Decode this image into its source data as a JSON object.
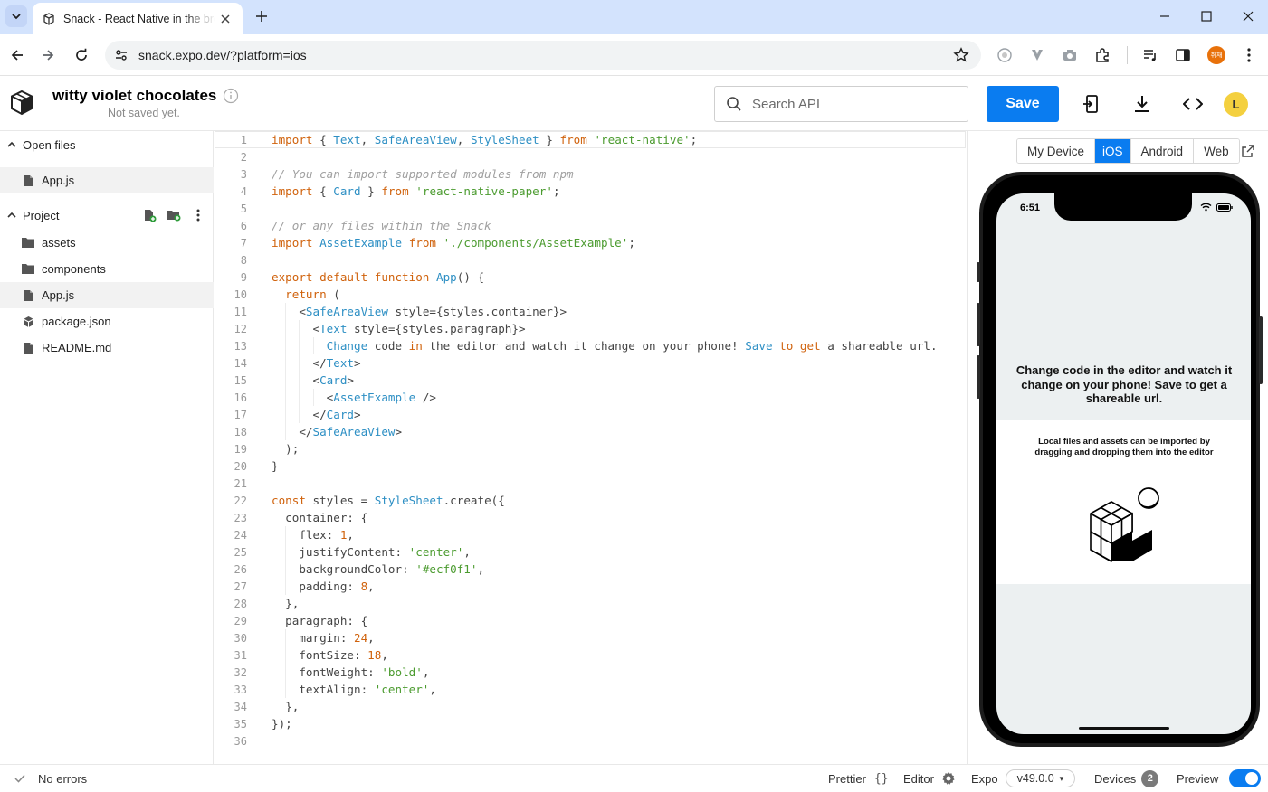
{
  "browser": {
    "tab_title": "Snack - React Native in the browser",
    "url": "snack.expo.dev/?platform=ios",
    "profile_badge": "취재"
  },
  "header": {
    "snack_name": "witty violet chocolates",
    "save_status": "Not saved yet.",
    "search_placeholder": "Search API",
    "save_label": "Save",
    "user_initial": "L"
  },
  "sidebar": {
    "open_files_label": "Open files",
    "open_files": [
      "App.js"
    ],
    "project_label": "Project",
    "project_items": [
      {
        "name": "assets",
        "icon": "folder-icon"
      },
      {
        "name": "components",
        "icon": "folder-icon"
      },
      {
        "name": "App.js",
        "icon": "file-icon"
      },
      {
        "name": "package.json",
        "icon": "package-icon"
      },
      {
        "name": "README.md",
        "icon": "file-icon"
      }
    ]
  },
  "editor": {
    "lines": [
      [
        [
          "kw",
          "import"
        ],
        [
          "pl",
          " { "
        ],
        [
          "id",
          "Text"
        ],
        [
          "pl",
          ", "
        ],
        [
          "id",
          "SafeAreaView"
        ],
        [
          "pl",
          ", "
        ],
        [
          "id",
          "StyleSheet"
        ],
        [
          "pl",
          " } "
        ],
        [
          "kw",
          "from"
        ],
        [
          "pl",
          " "
        ],
        [
          "str",
          "'react-native'"
        ],
        [
          "pl",
          ";"
        ]
      ],
      [],
      [
        [
          "cm",
          "// You can import supported modules from npm"
        ]
      ],
      [
        [
          "kw",
          "import"
        ],
        [
          "pl",
          " { "
        ],
        [
          "id",
          "Card"
        ],
        [
          "pl",
          " } "
        ],
        [
          "kw",
          "from"
        ],
        [
          "pl",
          " "
        ],
        [
          "str",
          "'react-native-paper'"
        ],
        [
          "pl",
          ";"
        ]
      ],
      [],
      [
        [
          "cm",
          "// or any files within the Snack"
        ]
      ],
      [
        [
          "kw",
          "import"
        ],
        [
          "pl",
          " "
        ],
        [
          "id",
          "AssetExample"
        ],
        [
          "pl",
          " "
        ],
        [
          "kw",
          "from"
        ],
        [
          "pl",
          " "
        ],
        [
          "str",
          "'./components/AssetExample'"
        ],
        [
          "pl",
          ";"
        ]
      ],
      [],
      [
        [
          "kw",
          "export default function"
        ],
        [
          "pl",
          " "
        ],
        [
          "id",
          "App"
        ],
        [
          "pl",
          "() {"
        ]
      ],
      [
        [
          "pl",
          "  "
        ],
        [
          "kw",
          "return"
        ],
        [
          "pl",
          " ("
        ]
      ],
      [
        [
          "pl",
          "    <"
        ],
        [
          "id",
          "SafeAreaView"
        ],
        [
          "pl",
          " style={styles.container}>"
        ]
      ],
      [
        [
          "pl",
          "      <"
        ],
        [
          "id",
          "Text"
        ],
        [
          "pl",
          " style={styles.paragraph}>"
        ]
      ],
      [
        [
          "pl",
          "        "
        ],
        [
          "id",
          "Change"
        ],
        [
          "pl",
          " code "
        ],
        [
          "kw",
          "in"
        ],
        [
          "pl",
          " the editor and watch it change on your phone! "
        ],
        [
          "id",
          "Save"
        ],
        [
          "pl",
          " "
        ],
        [
          "kw",
          "to"
        ],
        [
          "pl",
          " "
        ],
        [
          "kw",
          "get"
        ],
        [
          "pl",
          " a shareable url."
        ]
      ],
      [
        [
          "pl",
          "      </"
        ],
        [
          "id",
          "Text"
        ],
        [
          "pl",
          ">"
        ]
      ],
      [
        [
          "pl",
          "      <"
        ],
        [
          "id",
          "Card"
        ],
        [
          "pl",
          ">"
        ]
      ],
      [
        [
          "pl",
          "        <"
        ],
        [
          "id",
          "AssetExample"
        ],
        [
          "pl",
          " />"
        ]
      ],
      [
        [
          "pl",
          "      </"
        ],
        [
          "id",
          "Card"
        ],
        [
          "pl",
          ">"
        ]
      ],
      [
        [
          "pl",
          "    </"
        ],
        [
          "id",
          "SafeAreaView"
        ],
        [
          "pl",
          ">"
        ]
      ],
      [
        [
          "pl",
          "  );"
        ]
      ],
      [
        [
          "pl",
          "}"
        ]
      ],
      [],
      [
        [
          "kw",
          "const"
        ],
        [
          "pl",
          " styles = "
        ],
        [
          "id",
          "StyleSheet"
        ],
        [
          "pl",
          ".create({"
        ]
      ],
      [
        [
          "pl",
          "  container: {"
        ]
      ],
      [
        [
          "pl",
          "    flex: "
        ],
        [
          "num",
          "1"
        ],
        [
          "pl",
          ","
        ]
      ],
      [
        [
          "pl",
          "    justifyContent: "
        ],
        [
          "str",
          "'center'"
        ],
        [
          "pl",
          ","
        ]
      ],
      [
        [
          "pl",
          "    backgroundColor: "
        ],
        [
          "str",
          "'#ecf0f1'"
        ],
        [
          "pl",
          ","
        ]
      ],
      [
        [
          "pl",
          "    padding: "
        ],
        [
          "num",
          "8"
        ],
        [
          "pl",
          ","
        ]
      ],
      [
        [
          "pl",
          "  },"
        ]
      ],
      [
        [
          "pl",
          "  paragraph: {"
        ]
      ],
      [
        [
          "pl",
          "    margin: "
        ],
        [
          "num",
          "24"
        ],
        [
          "pl",
          ","
        ]
      ],
      [
        [
          "pl",
          "    fontSize: "
        ],
        [
          "num",
          "18"
        ],
        [
          "pl",
          ","
        ]
      ],
      [
        [
          "pl",
          "    fontWeight: "
        ],
        [
          "str",
          "'bold'"
        ],
        [
          "pl",
          ","
        ]
      ],
      [
        [
          "pl",
          "    textAlign: "
        ],
        [
          "str",
          "'center'"
        ],
        [
          "pl",
          ","
        ]
      ],
      [
        [
          "pl",
          "  },"
        ]
      ],
      [
        [
          "pl",
          "});"
        ]
      ],
      []
    ]
  },
  "preview": {
    "tabs": [
      "My Device",
      "iOS",
      "Android",
      "Web"
    ],
    "selected_tab": "iOS",
    "status_time": "6:51",
    "paragraph": "Change code in the editor and watch it change on your phone! Save to get a shareable url.",
    "card_text": "Local files and assets can be imported by dragging and dropping them into the editor",
    "screen_color": "#ecf0f1"
  },
  "footer": {
    "errors": "No errors",
    "prettier": "Prettier",
    "prettier_icon": "{}",
    "editor": "Editor",
    "expo": "Expo",
    "version": "v49.0.0",
    "version_caret": "▾",
    "devices": "Devices",
    "devices_count": "2",
    "preview": "Preview"
  },
  "colors": {
    "accent": "#0a7cf0",
    "keyword": "#d0620c",
    "identifier": "#2d8fc4",
    "string": "#4b9b2f",
    "comment": "#a0a0a0"
  }
}
